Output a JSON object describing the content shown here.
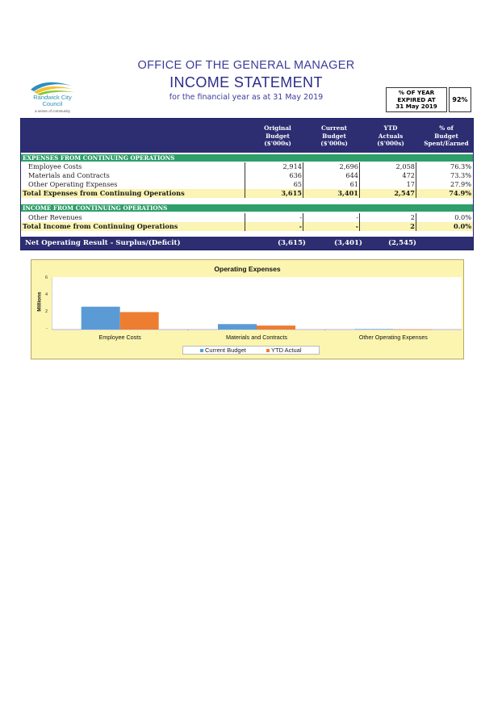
{
  "logo": {
    "line1": "Randwick City",
    "line2": "Council",
    "tagline": "a sense of community"
  },
  "header": {
    "office": "OFFICE OF THE GENERAL MANAGER",
    "title": "INCOME STATEMENT",
    "subtitle": "for the financial year as at 31 May 2019"
  },
  "year_expired": {
    "line1": "% OF YEAR",
    "line2": "EXPIRED AT",
    "line3": "31 May 2019",
    "value": "92%"
  },
  "table": {
    "columns": [
      {
        "l1": "Original",
        "l2": "Budget",
        "l3": "($'000s)"
      },
      {
        "l1": "Current",
        "l2": "Budget",
        "l3": "($'000s)"
      },
      {
        "l1": "YTD",
        "l2": "Actuals",
        "l3": "($'000s)"
      },
      {
        "l1": "% of",
        "l2": "Budget",
        "l3": "Spent/Earned"
      }
    ],
    "expenses_section": "EXPENSES FROM CONTINUING OPERATIONS",
    "expenses_rows": [
      {
        "label": "Employee Costs",
        "original": "2,914",
        "current": "2,696",
        "ytd": "2,058",
        "pct": "76.3%"
      },
      {
        "label": "Materials and Contracts",
        "original": "636",
        "current": "644",
        "ytd": "472",
        "pct": "73.3%"
      },
      {
        "label": "Other Operating Expenses",
        "original": "65",
        "current": "61",
        "ytd": "17",
        "pct": "27.9%"
      }
    ],
    "expenses_total": {
      "label": "Total Expenses from Continuing Operations",
      "original": "3,615",
      "current": "3,401",
      "ytd": "2,547",
      "pct": "74.9%"
    },
    "income_section": "INCOME FROM CONTINUING OPERATIONS",
    "income_rows": [
      {
        "label": "Other Revenues",
        "original": "-",
        "current": "-",
        "ytd": "2",
        "pct": "0.0%"
      }
    ],
    "income_total": {
      "label": "Total Income from Continuing Operations",
      "original": "-",
      "current": "-",
      "ytd": "2",
      "pct": "0.0%"
    },
    "net": {
      "label": "Net Operating Result - Surplus/(Deficit)",
      "original": "(3,615)",
      "current": "(3,401)",
      "ytd": "(2,545)"
    }
  },
  "chart_data": {
    "type": "bar",
    "title": "Operating Expenses",
    "ylabel": "Millions",
    "xlabel": "",
    "categories": [
      "Employee Costs",
      "Materials and Contracts",
      "Other Operating Expenses"
    ],
    "series": [
      {
        "name": "Current Budget",
        "values": [
          2.696,
          0.644,
          0.061
        ],
        "color": "#5b9bd5"
      },
      {
        "name": "YTD Actual",
        "values": [
          2.058,
          0.472,
          0.017
        ],
        "color": "#ed7d31"
      }
    ],
    "yticks": [
      "-",
      "2",
      "4",
      "6"
    ],
    "ylim": [
      0,
      6
    ],
    "legend": "bottom",
    "grid": false
  }
}
